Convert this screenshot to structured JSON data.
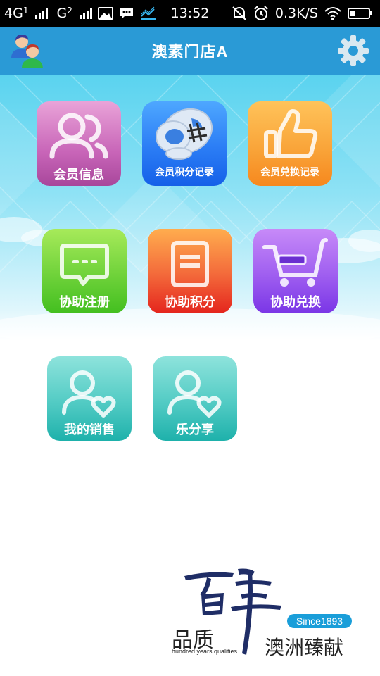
{
  "status_bar": {
    "network_1": "4G",
    "sim_1": "1",
    "network_2": "G",
    "sim_2": "2",
    "time": "13:52",
    "speed": "0.3K/S",
    "left_icons": [
      "signal-icon",
      "image-icon",
      "message-icon",
      "chart-icon"
    ],
    "right_icons": [
      "mute-icon",
      "alarm-icon",
      "wifi-icon",
      "battery-icon"
    ]
  },
  "header": {
    "title": "澳素门店A",
    "left_icon": "users-icon",
    "right_icon": "gear-icon"
  },
  "tiles": [
    {
      "label": "会员信息",
      "icon": "users-outline-icon",
      "color_top": "#e9a3d8",
      "color_bottom": "#b04fa4"
    },
    {
      "label": "会员积分记录",
      "icon": "coins-icon",
      "color_top": "#4ea7ff",
      "color_bottom": "#1560e8"
    },
    {
      "label": "会员兑换记录",
      "icon": "thumbs-up-icon",
      "color_top": "#ffc35a",
      "color_bottom": "#f6881e"
    },
    {
      "label": "协助注册",
      "icon": "chat-bubble-icon",
      "color_top": "#a7ea5a",
      "color_bottom": "#43bf20"
    },
    {
      "label": "协助积分",
      "icon": "document-icon",
      "color_top": "#ffad4e",
      "color_bottom": "#e4251d"
    },
    {
      "label": "协助兑换",
      "icon": "cart-icon",
      "color_top": "#c78af8",
      "color_bottom": "#7a36e6"
    },
    {
      "label": "我的销售",
      "icon": "user-heart-icon",
      "color_top": "#8ee3dc",
      "color_bottom": "#1eb1ab"
    },
    {
      "label": "乐分享",
      "icon": "user-heart-icon",
      "color_top": "#8ee3dc",
      "color_bottom": "#1eb1ab"
    }
  ],
  "footer": {
    "since": "Since1893",
    "quality": "品质",
    "quality_sub": "hundred years qualities",
    "brand": "澳洲臻献",
    "calligraphy": "百年"
  }
}
